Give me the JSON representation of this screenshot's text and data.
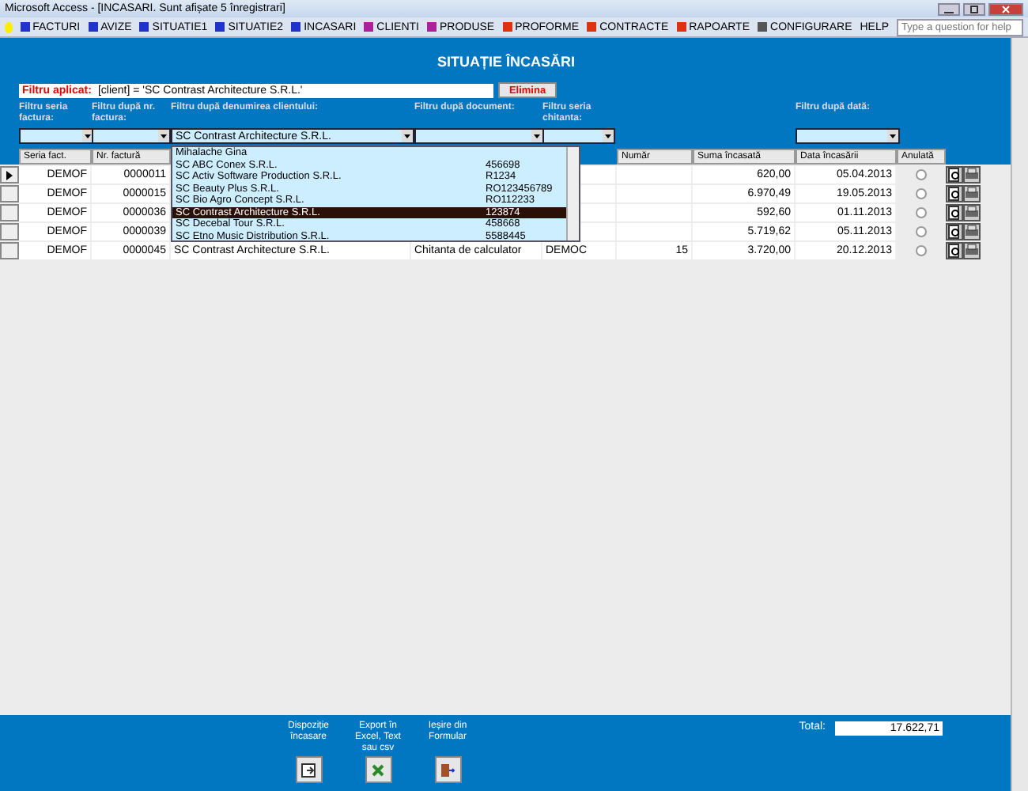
{
  "window": {
    "title": "Microsoft Access - [INCASARI. Sunt afișate 5 înregistrari]"
  },
  "menu": [
    "FACTURI",
    "AVIZE",
    "SITUATIE1",
    "SITUATIE2",
    "INCASARI",
    "CLIENTI",
    "PRODUSE",
    "PROFORME",
    "CONTRACTE",
    "RAPOARTE",
    "CONFIGURARE",
    "HELP"
  ],
  "help_search": {
    "placeholder": "Type a question for help"
  },
  "form_title": "SITUAȚIE ÎNCASĂRI",
  "filter": {
    "label": "Filtru aplicat:",
    "value": "[client] = 'SC Contrast Architecture S.R.L.'",
    "button": "Elimina"
  },
  "filters": [
    {
      "label": "Filtru seria factura:"
    },
    {
      "label": "Filtru după nr. factura:"
    },
    {
      "label": "Filtru după denumirea clientului:",
      "value": "SC Contrast Architecture S.R.L."
    },
    {
      "label": "Filtru după document:"
    },
    {
      "label": "Filtru seria chitanta:"
    },
    {
      "label": "Filtru după dată:"
    }
  ],
  "dropdown": [
    {
      "name": "Mihalache Gina",
      "selected": false
    },
    {
      "name": "SC ABC Conex S.R.L.",
      "code": "456698",
      "selected": false
    },
    {
      "name": "SC Activ Software Production S.R.L.",
      "code": "R1234",
      "selected": false
    },
    {
      "name": "SC Beauty Plus S.R.L.",
      "code": "RO123456789",
      "selected": false
    },
    {
      "name": "SC Bio Agro Concept S.R.L.",
      "code": "RO112233",
      "selected": false
    },
    {
      "name": "SC Contrast Architecture S.R.L.",
      "code": "123874",
      "selected": true
    },
    {
      "name": "SC Decebal Tour S.R.L.",
      "code": "458668",
      "selected": false
    },
    {
      "name": "SC Etno Music Distribution S.R.L.",
      "code": "5588445",
      "selected": false
    }
  ],
  "table": {
    "columns": [
      "Seria fact.",
      "Nr. factură",
      "",
      "",
      "",
      "Număr",
      "Suma încasată",
      "Data încasării",
      "Anulată"
    ],
    "rows": [
      {
        "current": true,
        "cells": [
          "DEMOF",
          "0000011",
          "",
          "",
          "",
          "",
          "620,00",
          "05.04.2013"
        ],
        "cancelled": false
      },
      {
        "current": false,
        "cells": [
          "DEMOF",
          "0000015",
          "",
          "",
          "",
          "",
          "6.970,49",
          "19.05.2013"
        ],
        "cancelled": false
      },
      {
        "current": false,
        "cells": [
          "DEMOF",
          "0000036",
          "",
          "",
          "",
          "",
          "592,60",
          "01.11.2013"
        ],
        "cancelled": false
      },
      {
        "current": false,
        "cells": [
          "DEMOF",
          "0000039",
          "",
          "",
          "",
          "",
          "5.719,62",
          "05.11.2013"
        ],
        "cancelled": false
      },
      {
        "current": false,
        "cells": [
          "DEMOF",
          "0000045",
          "SC Contrast Architecture S.R.L.",
          "Chitanta de calculator",
          "DEMOC",
          "15",
          "3.720,00",
          "20.12.2013"
        ],
        "cancelled": false
      }
    ]
  },
  "footer": {
    "buttons": [
      "Dispoziție încasare",
      "Export în Excel, Text sau csv",
      "Ieșire din Formular"
    ],
    "total_label": "Total:",
    "total": "17.622,71"
  }
}
